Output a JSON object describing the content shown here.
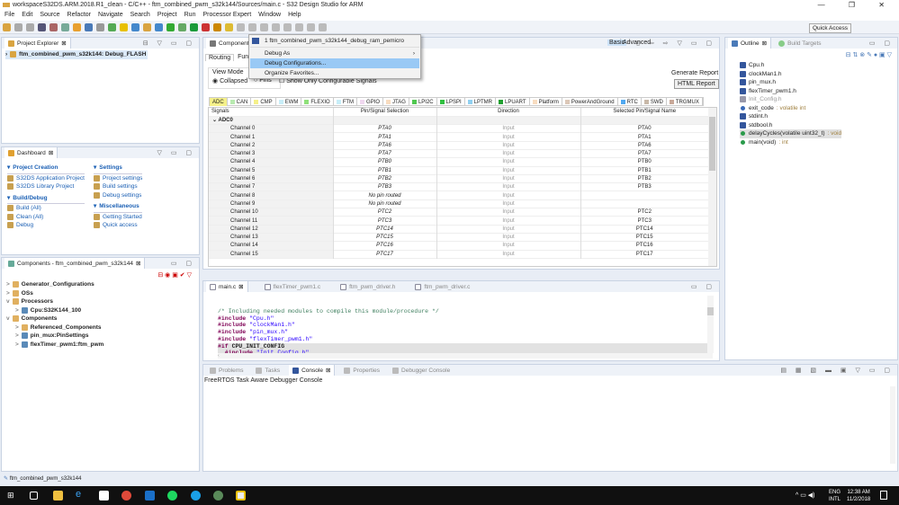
{
  "window": {
    "title": "workspaceS32DS.ARM.2018.R1_clean - C/C++ - ftm_combined_pwm_s32k144/Sources/main.c - S32 Design Studio for ARM",
    "controls": "— ❐ ✕"
  },
  "menu": [
    "File",
    "Edit",
    "Source",
    "Refactor",
    "Navigate",
    "Search",
    "Project",
    "Run",
    "Processor Expert",
    "Window",
    "Help"
  ],
  "toolbar": {
    "quick_access": "Quick Access"
  },
  "project_explorer": {
    "title": "Project Explorer",
    "item": "ftm_combined_pwm_s32k144: Debug_FLASH"
  },
  "dashboard": {
    "title": "Dashboard",
    "project_creation": {
      "title": "Project Creation",
      "items": [
        "S32DS Application Project",
        "S32DS Library Project"
      ]
    },
    "build_debug": {
      "title": "Build/Debug",
      "items": [
        "Build   (All)",
        "Clean   (All)",
        "Debug"
      ]
    },
    "settings": {
      "title": "Settings",
      "items": [
        "Project settings",
        "Build settings",
        "Debug settings"
      ]
    },
    "misc": {
      "title": "Miscellaneous",
      "items": [
        "Getting Started",
        "Quick access"
      ]
    }
  },
  "components": {
    "title": "Components - ftm_combined_pwm_s32k144",
    "tree": [
      {
        "label": "Generator_Configurations",
        "level": 0,
        "exp": ">"
      },
      {
        "label": "OSs",
        "level": 0,
        "exp": ">"
      },
      {
        "label": "Processors",
        "level": 0,
        "exp": "v"
      },
      {
        "label": "Cpu:S32K144_100",
        "level": 1,
        "exp": ">"
      },
      {
        "label": "Components",
        "level": 0,
        "exp": "v"
      },
      {
        "label": "Referenced_Components",
        "level": 1,
        "exp": ">"
      },
      {
        "label": "pin_mux:PinSettings",
        "level": 1,
        "exp": ">"
      },
      {
        "label": "flexTimer_pwm1:ftm_pwm",
        "level": 1,
        "exp": ">"
      }
    ]
  },
  "inspector": {
    "title": "Component I",
    "tabs": [
      "Routing",
      "Func"
    ],
    "basic": "Basic",
    "advanced": "Advanced",
    "view_mode": "View Mode",
    "collapsed": "Collapsed",
    "pins": "Pins",
    "show_only": "Show Only Configurable Signals",
    "generate_report": "Generate Report",
    "html_report": "HTML Report",
    "periph_tabs": [
      {
        "label": "ADC",
        "color": "#f5f08a"
      },
      {
        "label": "CAN",
        "color": "#b8eab0"
      },
      {
        "label": "CMP",
        "color": "#f5f08a"
      },
      {
        "label": "EWM",
        "color": "#c8eef8"
      },
      {
        "label": "FLEXIO",
        "color": "#8fe07a"
      },
      {
        "label": "FTM",
        "color": "#c8eef8"
      },
      {
        "label": "GPIO",
        "color": "#f0d8f0"
      },
      {
        "label": "JTAG",
        "color": "#f8dcc0"
      },
      {
        "label": "LPI2C",
        "color": "#50c850"
      },
      {
        "label": "LPSPI",
        "color": "#30c040"
      },
      {
        "label": "LPTMR",
        "color": "#90d0f0"
      },
      {
        "label": "LPUART",
        "color": "#20a030"
      },
      {
        "label": "Platform",
        "color": "#f8dcc0"
      },
      {
        "label": "PowerAndGround",
        "color": "#dcc8b8"
      },
      {
        "label": "RTC",
        "color": "#50a8f0"
      },
      {
        "label": "SWD",
        "color": "#c8b8a8"
      },
      {
        "label": "TRGMUX",
        "color": "#c8a898"
      }
    ],
    "columns": [
      "Signals",
      "Pin/Signal Selection",
      "Direction",
      "Selected Pin/Signal Name"
    ],
    "group": "ADC0",
    "rows": [
      [
        "Channel 0",
        "PTA0",
        "Input",
        "PTA0"
      ],
      [
        "Channel 1",
        "PTA1",
        "Input",
        "PTA1"
      ],
      [
        "Channel 2",
        "PTA6",
        "Input",
        "PTA6"
      ],
      [
        "Channel 3",
        "PTA7",
        "Input",
        "PTA7"
      ],
      [
        "Channel 4",
        "PTB0",
        "Input",
        "PTB0"
      ],
      [
        "Channel 5",
        "PTB1",
        "Input",
        "PTB1"
      ],
      [
        "Channel 6",
        "PTB2",
        "Input",
        "PTB2"
      ],
      [
        "Channel 7",
        "PTB3",
        "Input",
        "PTB3"
      ],
      [
        "Channel 8",
        "No pin routed",
        "Input",
        ""
      ],
      [
        "Channel 9",
        "No pin routed",
        "Input",
        ""
      ],
      [
        "Channel 10",
        "PTC2",
        "Input",
        "PTC2"
      ],
      [
        "Channel 11",
        "PTC3",
        "Input",
        "PTC3"
      ],
      [
        "Channel 12",
        "PTC14",
        "Input",
        "PTC14"
      ],
      [
        "Channel 13",
        "PTC15",
        "Input",
        "PTC15"
      ],
      [
        "Channel 14",
        "PTC16",
        "Input",
        "PTC16"
      ],
      [
        "Channel 15",
        "PTC17",
        "Input",
        "PTC17"
      ]
    ]
  },
  "debug_menu": {
    "recent": "1 ftm_combined_pwm_s32k144_debug_ram_pemicro",
    "debug_as": "Debug As",
    "debug_configs": "Debug Configurations...",
    "organize": "Organize Favorites..."
  },
  "editor": {
    "tabs": [
      "main.c",
      "flexTimer_pwm1.c",
      "ftm_pwm_driver.h",
      "ftm_pwm_driver.c"
    ],
    "lines": [
      {
        "t": "cm",
        "s": "/* Including needed modules to compile this module/procedure */"
      },
      {
        "t": "inc",
        "k": "#include",
        "s": "\"Cpu.h\""
      },
      {
        "t": "inc",
        "k": "#include",
        "s": "\"clockMan1.h\""
      },
      {
        "t": "inc",
        "k": "#include",
        "s": "\"pin_mux.h\""
      },
      {
        "t": "inc",
        "k": "#include",
        "s": "\"flexTimer_pwm1.h\""
      },
      {
        "t": "if",
        "k": "#if",
        "s": "CPU_INIT_CONFIG"
      },
      {
        "t": "inc2",
        "k": "  #include",
        "s": "\"Init_Config.h\""
      }
    ]
  },
  "outline": {
    "title": "Outline",
    "build_targets": "Build Targets",
    "items": [
      {
        "label": "Cpu.h",
        "type": "include"
      },
      {
        "label": "clockMan1.h",
        "type": "include"
      },
      {
        "label": "pin_mux.h",
        "type": "include"
      },
      {
        "label": "flexTimer_pwm1.h",
        "type": "include"
      },
      {
        "label": "Init_Config.h",
        "type": "include-inactive"
      },
      {
        "label": "exit_code",
        "suffix": " : volatile int",
        "type": "var"
      },
      {
        "label": "stdint.h",
        "type": "include"
      },
      {
        "label": "stdbool.h",
        "type": "include"
      },
      {
        "label": "delayCycles(volatile uint32_t)",
        "suffix": " : void",
        "type": "func",
        "selected": true
      },
      {
        "label": "main(void)",
        "suffix": " : int",
        "type": "func"
      }
    ]
  },
  "console": {
    "tabs": [
      "Problems",
      "Tasks",
      "Console",
      "Properties",
      "Debugger Console"
    ],
    "active": "Console",
    "text": "FreeRTOS Task Aware Debugger Console"
  },
  "status": {
    "text": "ftm_combined_pwm_s32k144"
  },
  "taskbar": {
    "lang1": "ENG",
    "lang2": "INTL",
    "time": "12:38 AM",
    "date": "11/2/2018"
  },
  "colors": {
    "accent": "#1a5fb4",
    "selection": "#99c9f5",
    "editor_tab_bg": "#ffffff",
    "taskbar": "#101010"
  }
}
